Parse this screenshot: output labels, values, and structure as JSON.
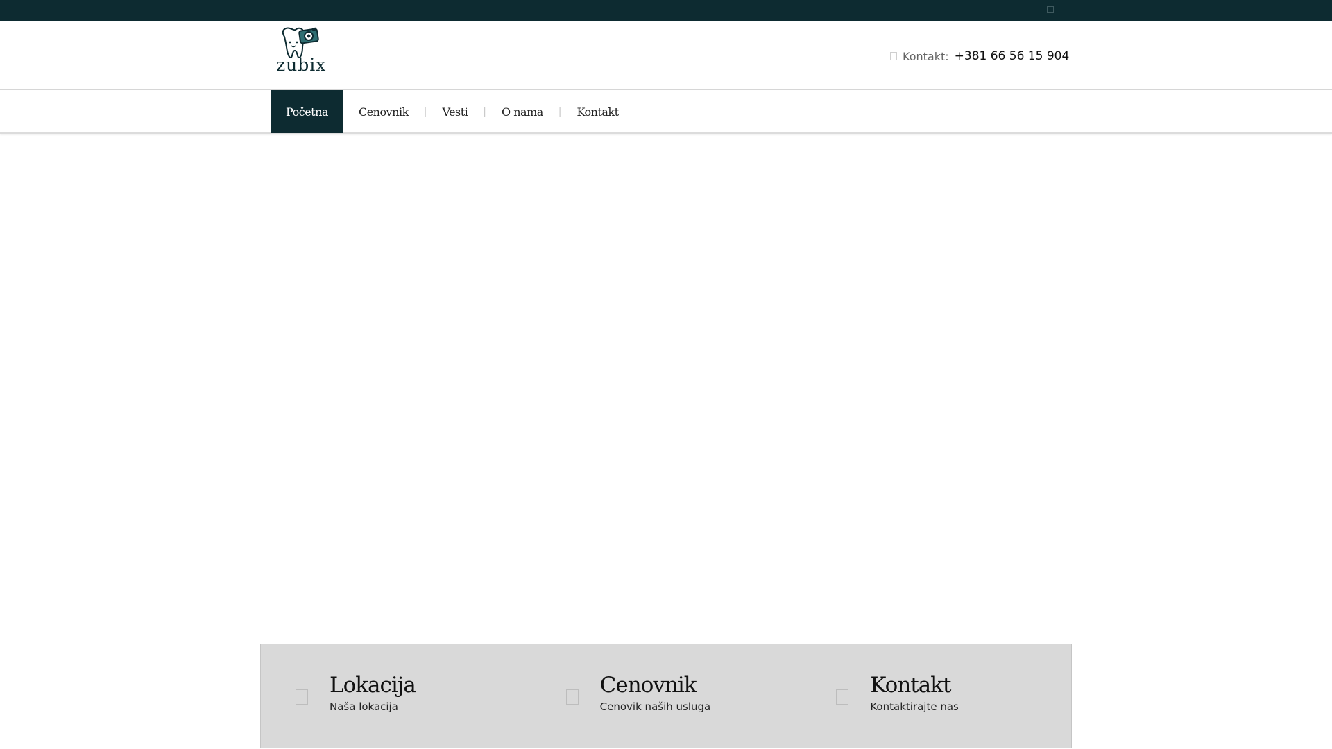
{
  "brand": {
    "logo_text": "zubix",
    "dark_color": "#0d2b31",
    "accent_color": "#2e6e72"
  },
  "header": {
    "contact_label": "Kontakt:",
    "contact_phone": "+381 66 56 15 904",
    "contact_icon": "phone-icon"
  },
  "nav": {
    "items": [
      {
        "label": "Početna",
        "active": true
      },
      {
        "label": "Cenovnik",
        "active": false
      },
      {
        "label": "Vesti",
        "active": false
      },
      {
        "label": "O nama",
        "active": false
      },
      {
        "label": "Kontakt",
        "active": false
      }
    ],
    "separator": "|"
  },
  "features": [
    {
      "title": "Lokacija",
      "subtitle": "Naša lokacija",
      "icon": "location-icon"
    },
    {
      "title": "Cenovnik",
      "subtitle": "Cenovik naših usluga",
      "icon": "price-icon"
    },
    {
      "title": "Kontakt",
      "subtitle": "Kontaktirajte nas",
      "icon": "contact-icon"
    }
  ]
}
